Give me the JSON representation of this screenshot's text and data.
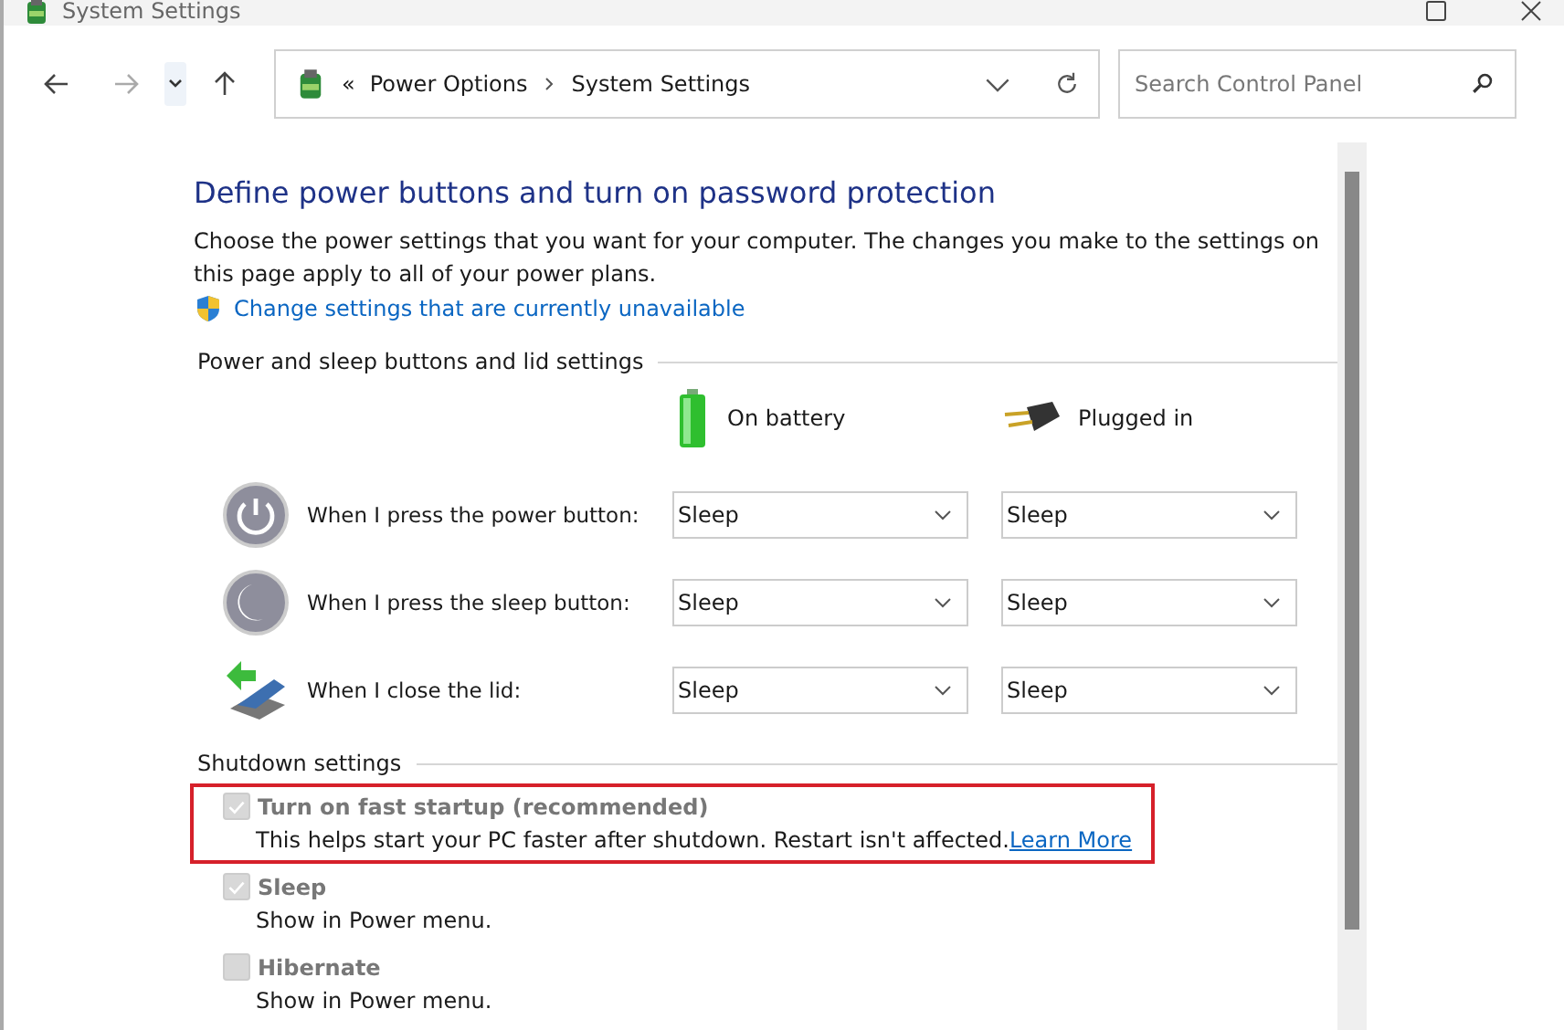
{
  "window": {
    "title": "System Settings"
  },
  "nav": {
    "back_disabled": false,
    "forward_disabled": true
  },
  "address": {
    "overflow": "«",
    "crumbs": [
      "Power Options",
      "System Settings"
    ]
  },
  "search": {
    "placeholder": "Search Control Panel"
  },
  "heading": "Define power buttons and turn on password protection",
  "intro": "Choose the power settings that you want for your computer. The changes you make to the settings on this page apply to all of your power plans.",
  "admin_link": "Change settings that are currently unavailable",
  "buttons_section": {
    "title": "Power and sleep buttons and lid settings",
    "columns": [
      {
        "kind": "battery",
        "label": "On battery"
      },
      {
        "kind": "plug",
        "label": "Plugged in"
      }
    ],
    "rows": [
      {
        "kind": "power",
        "label": "When I press the power button:",
        "values": [
          "Sleep",
          "Sleep"
        ]
      },
      {
        "kind": "sleep",
        "label": "When I press the sleep button:",
        "values": [
          "Sleep",
          "Sleep"
        ]
      },
      {
        "kind": "lid",
        "label": "When I close the lid:",
        "values": [
          "Sleep",
          "Sleep"
        ]
      }
    ]
  },
  "shutdown_section": {
    "title": "Shutdown settings",
    "options": [
      {
        "label": "Turn on fast startup (recommended)",
        "description": "This helps start your PC faster after shutdown. Restart isn't affected.",
        "link": "Learn More",
        "checked": true,
        "disabled": true,
        "highlighted": true
      },
      {
        "label": "Sleep",
        "description": "Show in Power menu.",
        "checked": true,
        "disabled": true,
        "highlighted": false
      },
      {
        "label": "Hibernate",
        "description": "Show in Power menu.",
        "checked": false,
        "disabled": true,
        "highlighted": false
      }
    ]
  }
}
